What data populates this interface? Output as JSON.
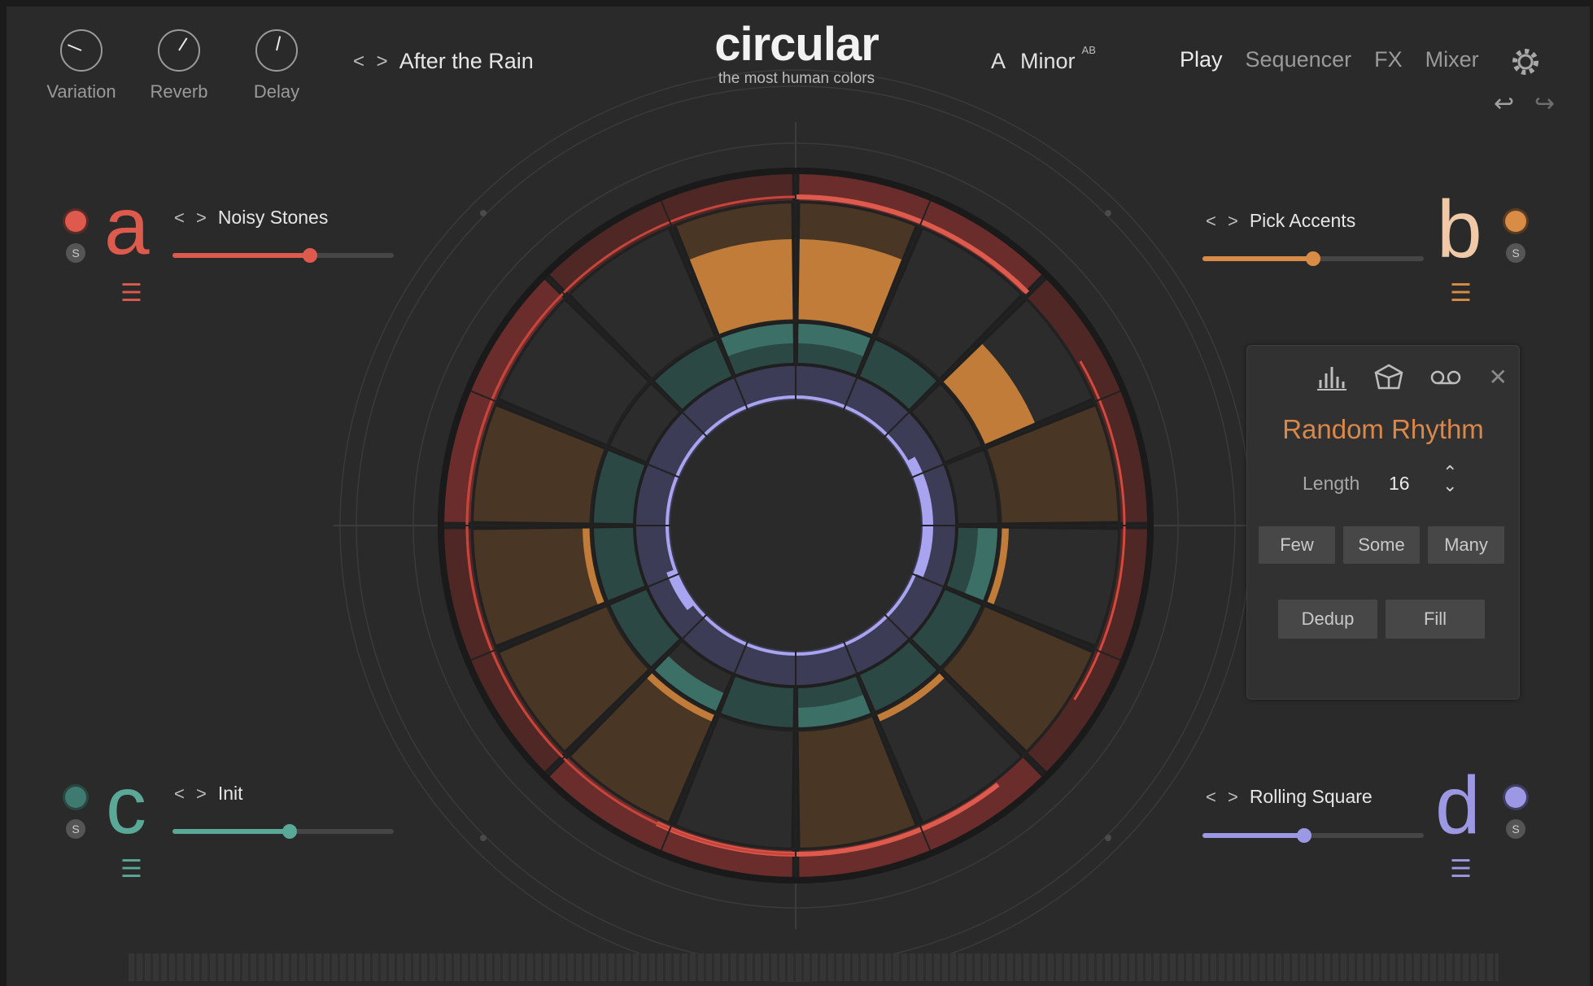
{
  "knobs": [
    {
      "label": "Variation",
      "value": 0.25
    },
    {
      "label": "Reverb",
      "value": 0.62
    },
    {
      "label": "Delay",
      "value": 0.55
    }
  ],
  "preset": {
    "arrows": "< >",
    "name": "After the Rain"
  },
  "logo": {
    "title": "circular",
    "subtitle": "the most human colors"
  },
  "scale": {
    "key": "A",
    "mode": "Minor",
    "ab": "AB"
  },
  "nav": {
    "play": "Play",
    "sequencer": "Sequencer",
    "fx": "FX",
    "mixer": "Mixer"
  },
  "icons": {
    "settings": "gear-icon",
    "undo": "↩",
    "redo": "↪",
    "menu": "☰",
    "close": "✕"
  },
  "layers": {
    "a": {
      "letter": "a",
      "solo": "S",
      "arrows": "< >",
      "name": "Noisy Stones",
      "color": "#dd5a4c",
      "level": 0.62
    },
    "b": {
      "letter": "b",
      "solo": "S",
      "arrows": "< >",
      "name": "Pick Accents",
      "color": "#d98c45",
      "level": 0.5
    },
    "c": {
      "letter": "c",
      "solo": "S",
      "arrows": "< >",
      "name": "Init",
      "color": "#5aa898",
      "level": 0.53
    },
    "d": {
      "letter": "d",
      "solo": "S",
      "arrows": "< >",
      "name": "Rolling Square",
      "color": "#9d98e3",
      "level": 0.46
    }
  },
  "panel": {
    "title": "Random Rhythm",
    "length_label": "Length",
    "length_value": "16",
    "stepper_up": "⌃",
    "stepper_down": "⌄",
    "buttons": {
      "few": "Few",
      "some": "Some",
      "many": "Many",
      "dedup": "Dedup",
      "fill": "Fill"
    },
    "icons": [
      "bars-chart-icon",
      "polyhedron-icon",
      "tape-icon"
    ]
  }
}
